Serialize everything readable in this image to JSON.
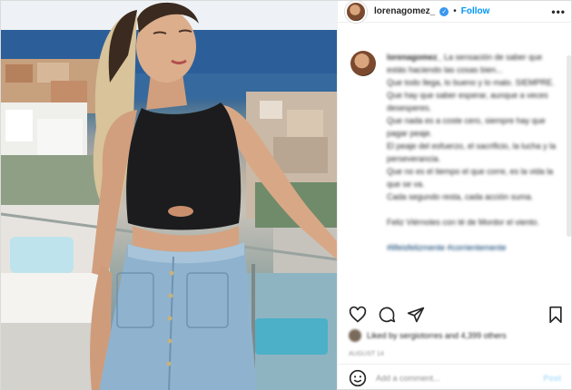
{
  "header": {
    "username": "lorenagomez_",
    "follow_label": "Follow",
    "more_label": "•••",
    "dot": "•"
  },
  "caption": {
    "username": "lorenagomez_",
    "text": "La sensación de saber que estás haciendo las cosas bien...\nQue todo llega, lo bueno y lo malo. SIEMPRE.\nQue hay que saber esperar, aunque a veces desesperes.\nQue nada es a coste cero, siempre hay que pagar peaje.\nEl peaje del esfuerzo, el sacrificio, la lucha y la perseverancia.\nQue no es el tiempo el que corre, es la vida la que se va.\nCada segundo resta, cada acción suma.\n\nFeliz Viérnoles con té de Mordor el viento.",
    "hashtags": "#lifeisfelizmente #corrientemente"
  },
  "likes": {
    "text": "Liked by sergiotorres and 4,399 others"
  },
  "time_ago": "August 14",
  "comment": {
    "placeholder": "Add a comment...",
    "post_label": "Post"
  },
  "colors": {
    "accent": "#0095f6",
    "verified": "#3897f0",
    "text": "#262626",
    "muted": "#8e8e8e",
    "border": "#dbdbdb"
  },
  "icons": {
    "header_more": "more-icon",
    "like": "heart-icon",
    "comment": "comment-icon",
    "share": "share-icon",
    "save": "bookmark-icon",
    "emoji": "emoji-icon",
    "verified": "verified-badge-icon"
  }
}
